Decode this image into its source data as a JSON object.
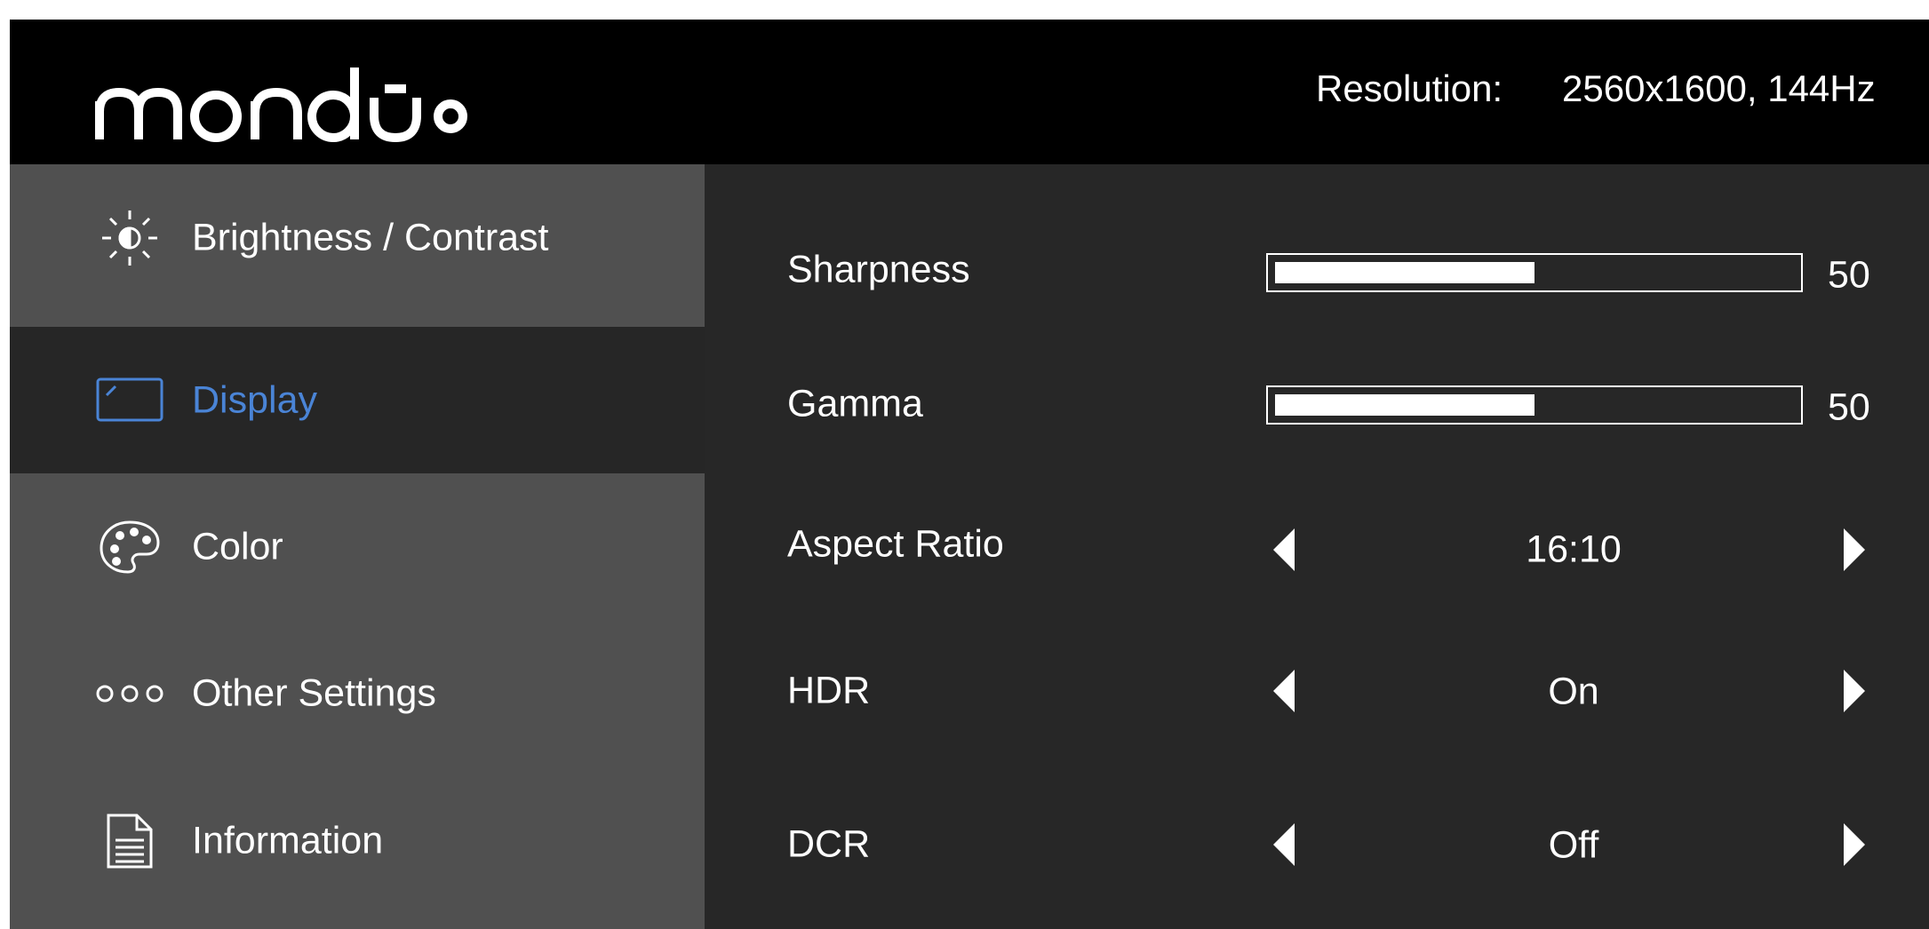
{
  "header": {
    "logo_text": "monduo",
    "resolution_label": "Resolution:",
    "resolution_value": "2560x1600, 144Hz"
  },
  "sidebar": {
    "items": [
      {
        "label": "Brightness / Contrast",
        "icon": "brightness-icon",
        "active": false
      },
      {
        "label": "Display",
        "icon": "display-icon",
        "active": true
      },
      {
        "label": "Color",
        "icon": "palette-icon",
        "active": false
      },
      {
        "label": "Other Settings",
        "icon": "dots-icon",
        "active": false
      },
      {
        "label": "Information",
        "icon": "document-icon",
        "active": false
      }
    ]
  },
  "settings": {
    "sharpness": {
      "label": "Sharpness",
      "value": "50",
      "level": 0.5
    },
    "gamma": {
      "label": "Gamma",
      "value": "50",
      "level": 0.5
    },
    "aspect_ratio": {
      "label": "Aspect Ratio",
      "value": "16:10"
    },
    "hdr": {
      "label": "HDR",
      "value": "On"
    },
    "dcr": {
      "label": "DCR",
      "value": "Off"
    }
  },
  "colors": {
    "accent": "#4a84d6",
    "header_bg": "#000000",
    "sidebar_bg": "#505050",
    "panel_bg": "#272727"
  }
}
